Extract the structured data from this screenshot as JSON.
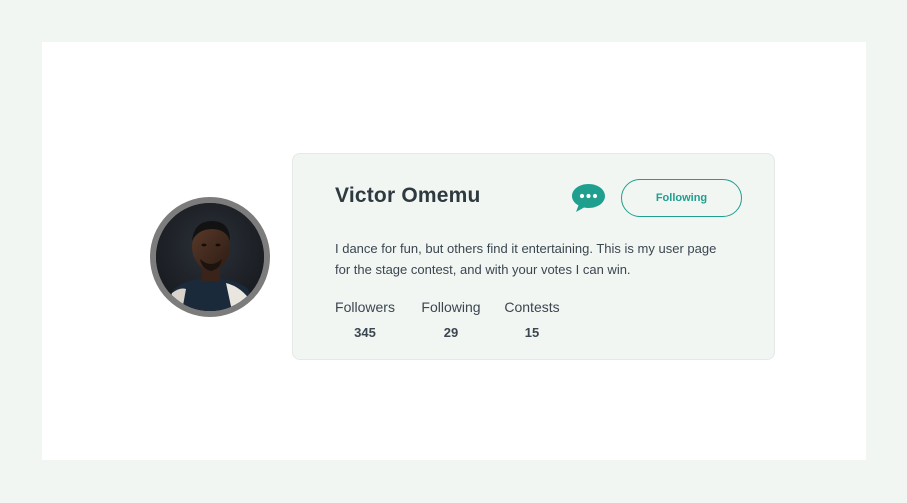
{
  "profile": {
    "name": "Victor Omemu",
    "avatar_alt": "Victor Omemu profile photo",
    "bio": "I dance for fun, but others find it entertaining. This is my user page for the stage contest, and with your votes I can win.",
    "follow_button_label": "Following",
    "message_icon": "chat-bubble-icon"
  },
  "stats": [
    {
      "label": "Followers",
      "value": "345"
    },
    {
      "label": "Following",
      "value": "29"
    },
    {
      "label": "Contests",
      "value": "15"
    }
  ],
  "colors": {
    "accent": "#1f9f8e",
    "card_background": "#f1f6f2",
    "page_background": "#f2f6f2",
    "text": "#2f3a40"
  }
}
